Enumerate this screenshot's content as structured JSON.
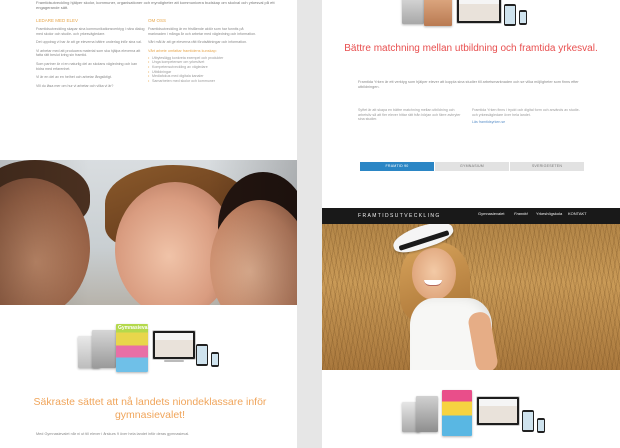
{
  "left_page": {
    "intro": "Framtidsutveckling hjälper skolor, kommuner, organisationer och myndigheter att kommunicera budskap om skolval och yrkesval på ett engagerande sätt.",
    "col1_heading": "LEDARE MED ELEV",
    "col1_paragraphs": [
      "Framtidsutveckling skapar sina kommunikationsverktyg i nära dialog med skolor och studie- och yrkesvägledare.",
      "Det uppdrag vi har är att ge eleverna bättre underlag inför sina val.",
      "Vi arbetar med att producera material som ska hjälpa eleverna att fatta rätt beslut kring sin framtid.",
      "Som partner är vi en naturlig del av skolans vägledning och kan bidra med erfarenhet.",
      "Vi är en del av en helhet och arbetar långsiktigt.",
      "Vill du läsa mer om hur vi arbetar och vilka vi är?"
    ],
    "col2_heading": "OM OSS",
    "col2_paragraphs": [
      "Framtidsutveckling är en fristående aktör som har funnits på marknaden i många år och arbetar med vägledning och information.",
      "Vårt mål är att ge eleverna rätt förutsättningar och information."
    ],
    "col2_subheading": "Vårt arbete omfattar framtidens kunskap:",
    "col2_list": [
      "Utbyteslägg konkreta exempel och produkter",
      "Unga kompetenser om yrkeslivet",
      "Kompetensutveckling av vägledare",
      "Utbildningar",
      "Mediafokus med digitala kanaler",
      "Samarbeten med skolor och kommuner"
    ],
    "headline": "Säkraste sättet att nå landets niondeklassare inför gymnasievalet!",
    "body": "Med Gymnasievalet når ni ut till elever i årskurs 9 över hela landet inför deras gymnasieval.",
    "magazine_title": "Gymnasievalet"
  },
  "right_page": {
    "headline": "Bättre matchning mellan utbildning och framtida yrkesval.",
    "intro": "Framtida Yrken är ett verktyg som hjälper elever att koppla sina studier till arbetsmarknaden och se vilka möjligheter som finns efter utbildningen.",
    "col1_text": "Syftet är att skapa en bättre matchning mellan utbildning och arbetsliv så att fler elever hittar rätt från början och färre avbryter sina studier.",
    "col2_text": "Framtida Yrken finns i tryckt och digital form och används av studie- och yrkesvägledare över hela landet.",
    "link": "Läs framtidsyrken.se",
    "tabs": [
      {
        "label": "Framtid 90"
      },
      {
        "label": "Gymnasium"
      },
      {
        "label": "Sverigeseten"
      }
    ],
    "nav_brand": "FRAMTIDSUTVECKLING",
    "nav_items": [
      {
        "label": "Gymnasievalet"
      },
      {
        "label": "Framtid"
      },
      {
        "label": "Yrkeshögskola"
      },
      {
        "label": "KONTAKT"
      }
    ]
  },
  "colors": {
    "orange_accent": "#f0a55b",
    "red_accent": "#e84f4f",
    "tab_active": "#2b86c5",
    "nav_bg": "#191919"
  }
}
